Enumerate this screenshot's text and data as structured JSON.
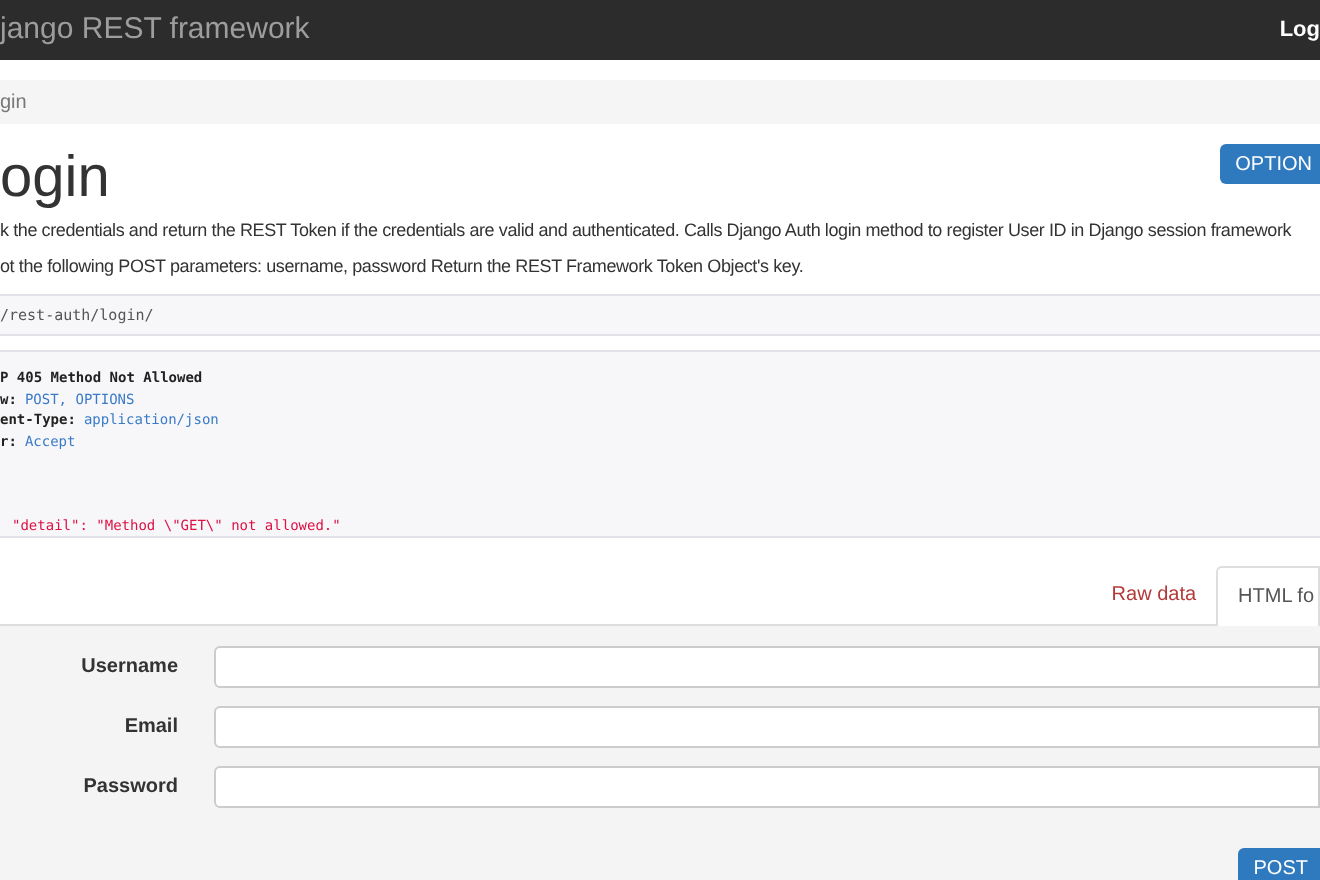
{
  "navbar": {
    "brand": "jango REST framework",
    "user_link": "Log"
  },
  "breadcrumb": {
    "current": "gin"
  },
  "header": {
    "title": "ogin",
    "options_button": "OPTION"
  },
  "description": [
    "k the credentials and return the REST Token if the credentials are valid and authenticated. Calls Django Auth login method to register User ID in Django session framework",
    "ot the following POST parameters: username, password Return the REST Framework Token Object's key."
  ],
  "request": {
    "url": "/rest-auth/login/"
  },
  "response": {
    "status": "P 405 Method Not Allowed",
    "headers": [
      {
        "name": "w:",
        "value": "POST, OPTIONS"
      },
      {
        "name": "ent-Type:",
        "value": "application/json"
      },
      {
        "name": "r:",
        "value": "Accept"
      }
    ],
    "body": "\"detail\": \"Method \\\"GET\\\" not allowed.\""
  },
  "tabs": [
    {
      "label": "Raw data",
      "selected": false
    },
    {
      "label": "HTML fo",
      "selected": true
    }
  ],
  "form": {
    "fields": [
      {
        "label": "Username"
      },
      {
        "label": "Email"
      },
      {
        "label": "Password"
      }
    ],
    "submit": "POST"
  }
}
